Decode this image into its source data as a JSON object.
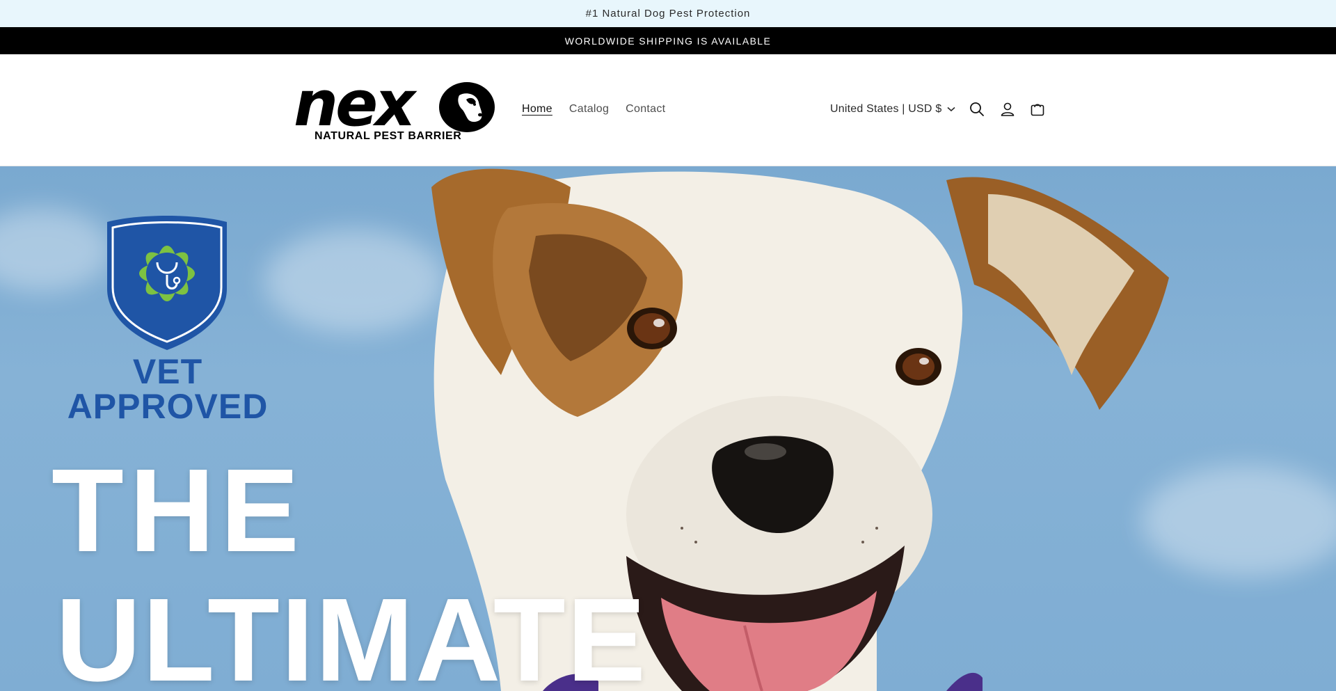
{
  "announcements": {
    "top": "#1 Natural Dog Pest Protection",
    "shipping": "WORLDWIDE SHIPPING IS AVAILABLE"
  },
  "logo": {
    "wordmark": "nex",
    "tagline": "NATURAL PEST BARRIER"
  },
  "nav": {
    "items": [
      {
        "label": "Home",
        "active": true
      },
      {
        "label": "Catalog",
        "active": false
      },
      {
        "label": "Contact",
        "active": false
      }
    ]
  },
  "locale": {
    "label": "United States | USD $"
  },
  "icons": {
    "search": "search-icon",
    "account": "account-icon",
    "cart": "cart-icon",
    "chevron": "chevron-down-icon"
  },
  "hero": {
    "badge_line1": "VET",
    "badge_line2": "APPROVED",
    "headline_line1": "THE",
    "headline_line2": "ULTIMATE"
  },
  "colors": {
    "announce_bg": "#e8f6fc",
    "shipping_bg": "#000000",
    "badge_blue": "#1f55a6",
    "badge_green": "#7dc242",
    "sky": "#7aa9d0"
  }
}
